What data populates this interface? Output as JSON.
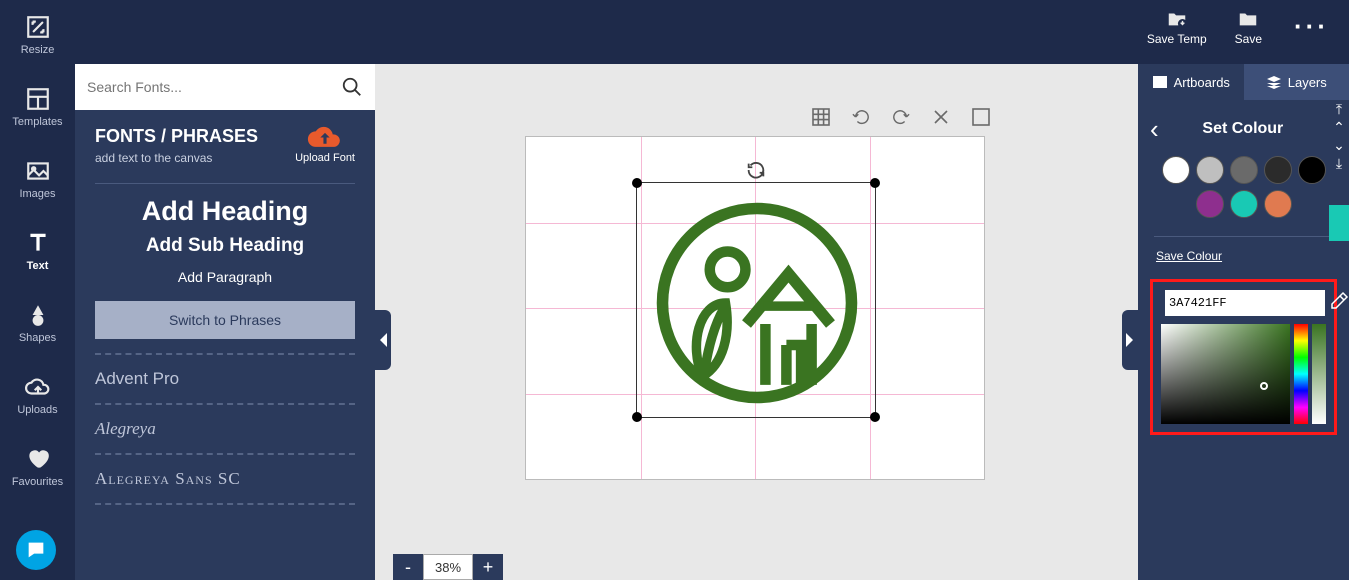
{
  "topbar": {
    "save_temp": "Save Temp",
    "save": "Save"
  },
  "rail": {
    "resize": "Resize",
    "templates": "Templates",
    "images": "Images",
    "text": "Text",
    "shapes": "Shapes",
    "uploads": "Uploads",
    "favourites": "Favourites"
  },
  "fonts_panel": {
    "search_placeholder": "Search Fonts...",
    "title": "FONTS / PHRASES",
    "subtitle": "add text to the canvas",
    "upload": "Upload Font",
    "add_heading": "Add Heading",
    "add_subheading": "Add Sub Heading",
    "add_paragraph": "Add Paragraph",
    "switch": "Switch to Phrases",
    "fonts": [
      "Advent Pro",
      "Alegreya",
      "Alegreya Sans SC"
    ]
  },
  "zoom": {
    "value": "38%"
  },
  "right": {
    "tab_artboards": "Artboards",
    "tab_layers": "Layers",
    "section_title": "Set Colour",
    "save_colour": "Save Colour",
    "hex": "3A7421FF",
    "swatches": [
      "#ffffff",
      "#bfbfbf",
      "#6a6a6a",
      "#2b2b2b",
      "#000000",
      "#8e2f8e",
      "#19c9b4",
      "#e07a50"
    ]
  }
}
